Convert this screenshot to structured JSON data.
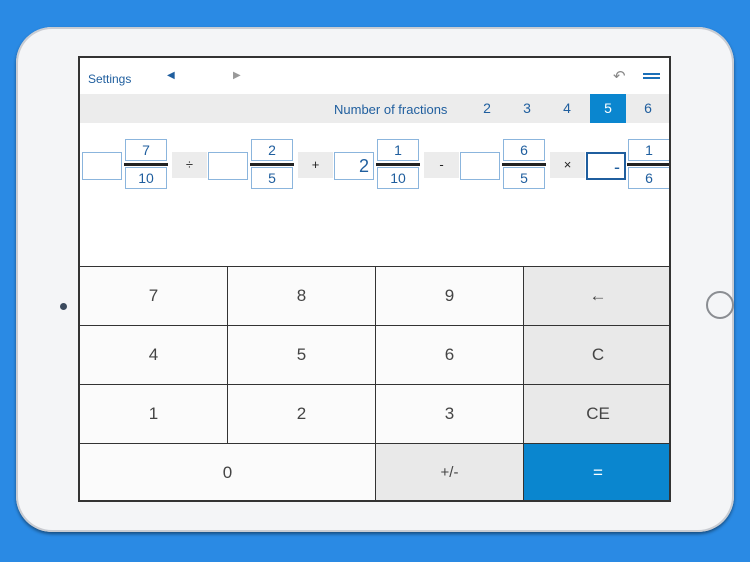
{
  "device": {
    "camera": "camera-dot",
    "home_button": "home-button"
  },
  "topbar": {
    "settings_label": "Settings",
    "prev_icon": "◀",
    "next_icon": "▶",
    "undo_icon": "↶"
  },
  "fraction_count": {
    "label": "Number of fractions",
    "options": [
      "2",
      "3",
      "4",
      "5",
      "6"
    ],
    "selected": "5"
  },
  "expression": {
    "terms": [
      {
        "whole": "",
        "numerator": "7",
        "denominator": "10"
      },
      {
        "whole": "",
        "numerator": "2",
        "denominator": "5"
      },
      {
        "whole": "2",
        "numerator": "1",
        "denominator": "10"
      },
      {
        "whole": "",
        "numerator": "6",
        "denominator": "5"
      },
      {
        "whole": "-",
        "numerator": "1",
        "denominator": "6",
        "active": true
      }
    ],
    "operators": [
      "÷",
      "+",
      "-",
      "×"
    ]
  },
  "keypad": {
    "rows": [
      [
        "7",
        "8",
        "9",
        "←"
      ],
      [
        "4",
        "5",
        "6",
        "C"
      ],
      [
        "1",
        "2",
        "3",
        "CE"
      ],
      [
        "0",
        "+/-",
        "="
      ]
    ]
  },
  "colors": {
    "accent": "#0a86cf",
    "text": "#1f5e9e",
    "background": "#2a8ae4"
  }
}
